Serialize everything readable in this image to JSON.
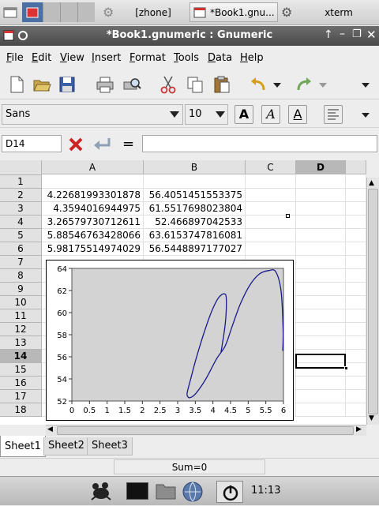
{
  "taskbar": {
    "window_buttons": [
      "[zhone]",
      "*Book1.gnu...",
      "xterm"
    ]
  },
  "window": {
    "title": "*Book1.gnumeric : Gnumeric"
  },
  "menubar": {
    "items": [
      {
        "label": "File",
        "mnemonic": "F",
        "rest": "ile"
      },
      {
        "label": "Edit",
        "mnemonic": "E",
        "rest": "dit"
      },
      {
        "label": "View",
        "mnemonic": "V",
        "rest": "iew"
      },
      {
        "label": "Insert",
        "mnemonic": "I",
        "rest": "nsert"
      },
      {
        "label": "Format",
        "mnemonic": "F",
        "rest": "ormat"
      },
      {
        "label": "Tools",
        "mnemonic": "T",
        "rest": "ools"
      },
      {
        "label": "Data",
        "mnemonic": "D",
        "rest": "ata"
      },
      {
        "label": "Help",
        "mnemonic": "H",
        "rest": "elp"
      }
    ]
  },
  "toolbar": {
    "icons": [
      "new-file-icon",
      "open-folder-icon",
      "save-icon",
      "print-icon",
      "print-preview-icon",
      "cut-icon",
      "copy-icon",
      "paste-icon",
      "undo-icon",
      "redo-icon"
    ]
  },
  "format_bar": {
    "font_name": "Sans",
    "font_size": "10",
    "bold_label": "A",
    "italic_label": "A",
    "underline_label": "A"
  },
  "formula_bar": {
    "cell_ref": "D14",
    "equals_label": "=",
    "formula": ""
  },
  "sheet": {
    "columns": [
      "A",
      "B",
      "C",
      "D"
    ],
    "selected_column": "D",
    "rows": [
      "1",
      "2",
      "3",
      "4",
      "5",
      "6",
      "7",
      "8",
      "9",
      "10",
      "11",
      "12",
      "13",
      "14",
      "15",
      "16",
      "17",
      "18"
    ],
    "selected_row": "14",
    "cells": [
      {
        "row": 2,
        "a": "4.22681993301878",
        "b": "56.4051451553375"
      },
      {
        "row": 3,
        "a": "4.3594016944975",
        "b": "61.5517698023804"
      },
      {
        "row": 4,
        "a": "3.26579730712611",
        "b": "52.466897042533"
      },
      {
        "row": 5,
        "a": "5.88546763428066",
        "b": "63.6153747816081"
      },
      {
        "row": 6,
        "a": "5.98175514974029",
        "b": "56.5448897177027"
      }
    ]
  },
  "chart_data": {
    "type": "line",
    "title": "",
    "xlabel": "",
    "ylabel": "",
    "xlim": [
      0,
      6
    ],
    "ylim": [
      52,
      64
    ],
    "xticks": [
      "0",
      "0.5",
      "1",
      "1.5",
      "2",
      "2.5",
      "3",
      "3.5",
      "4",
      "4.5",
      "5",
      "5.5",
      "6"
    ],
    "yticks": [
      "52",
      "54",
      "56",
      "58",
      "60",
      "62",
      "64"
    ],
    "grid": false,
    "series_color": "#1a1a8c",
    "plot_bg": "#d3d3d3",
    "series": [
      {
        "x": [
          4.23,
          4.35,
          4.38,
          4.32,
          4.15,
          3.95,
          3.73,
          3.52,
          3.37,
          3.28,
          3.27,
          3.35,
          3.52,
          3.8,
          4.1,
          4.35,
          4.55,
          4.78,
          5.05,
          5.32,
          5.58,
          5.78,
          5.93,
          5.99,
          5.98
        ],
        "y": [
          56.41,
          59.0,
          61.2,
          61.7,
          61.3,
          60.0,
          58.0,
          55.8,
          54.0,
          52.9,
          52.5,
          52.3,
          52.7,
          54.0,
          55.8,
          57.0,
          58.8,
          60.8,
          62.5,
          63.5,
          63.8,
          63.7,
          62.0,
          58.5,
          56.54
        ]
      }
    ]
  },
  "sheet_tabs": [
    "Sheet1",
    "Sheet2",
    "Sheet3"
  ],
  "active_tab": "Sheet1",
  "status": {
    "sum": "Sum=0"
  },
  "dock": {
    "clock": "11:13"
  }
}
